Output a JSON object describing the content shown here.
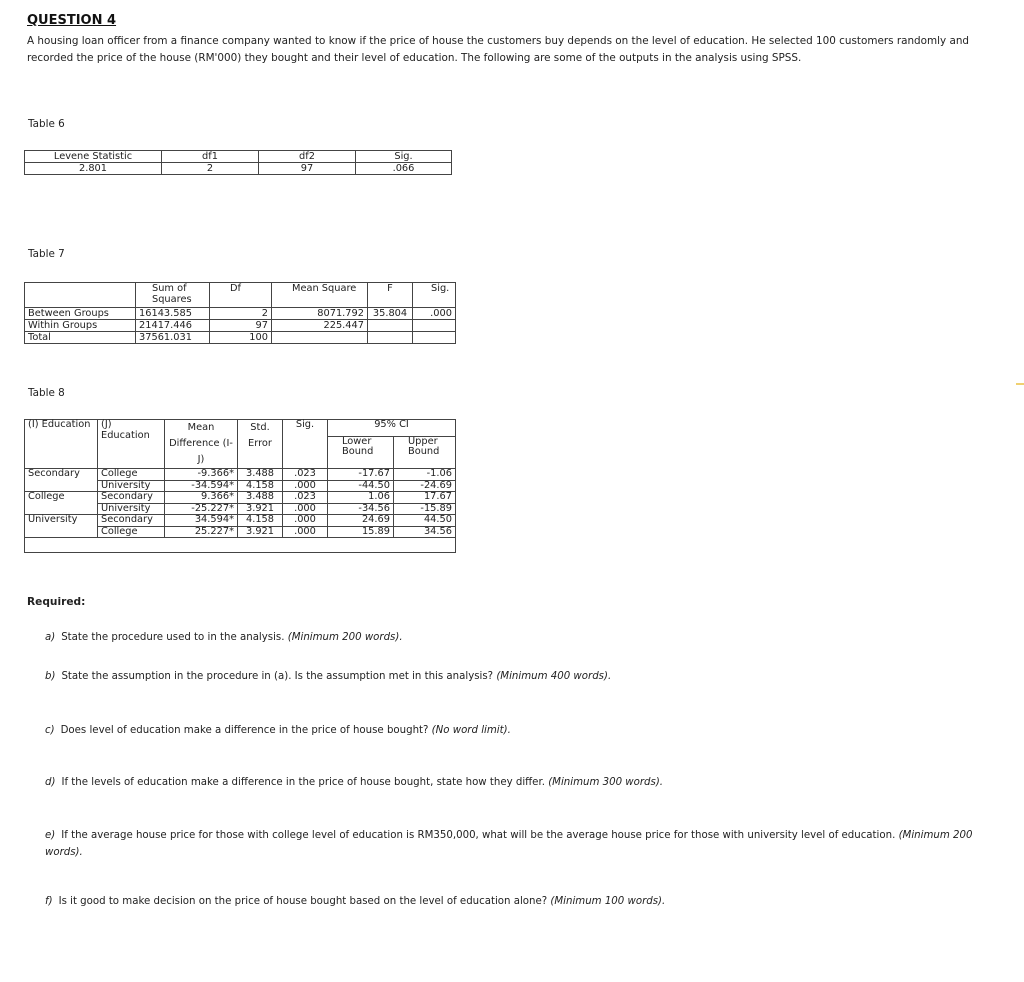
{
  "question": {
    "title": "QUESTION 4",
    "intro": "A housing loan officer from a finance company wanted to know if the price of house the customers buy depends on the level of education. He selected 100 customers randomly and recorded the price of the house (RM'000) they bought and their level of education. The following are some of the outputs in the analysis using SPSS."
  },
  "table6": {
    "label": "Table 6",
    "headers": [
      "Levene Statistic",
      "df1",
      "df2",
      "Sig."
    ],
    "row": [
      "2.801",
      "2",
      "97",
      ".066"
    ]
  },
  "table7": {
    "label": "Table 7",
    "headers": [
      "",
      "Sum of Squares",
      "Df",
      "Mean Square",
      "F",
      "Sig."
    ],
    "rows": [
      [
        "Between Groups",
        "16143.585",
        "2",
        "8071.792",
        "35.804",
        ".000"
      ],
      [
        "Within Groups",
        "21417.446",
        "97",
        "225.447",
        "",
        ""
      ],
      [
        "Total",
        "37561.031",
        "100",
        "",
        "",
        ""
      ]
    ]
  },
  "table8": {
    "label": "Table 8",
    "headers": {
      "i": "(I) Education",
      "j": "(J) Education",
      "mean_diff": "Mean Difference (I-J)",
      "std_error": "Std. Error",
      "sig": "Sig.",
      "ci": "95% CI",
      "lower": "Lower Bound",
      "upper": "Upper Bound"
    },
    "rows": [
      {
        "i": "Secondary",
        "j": "College",
        "md": "-9.366*",
        "se": "3.488",
        "sig": ".023",
        "lo": "-17.67",
        "hi": "-1.06"
      },
      {
        "i": "",
        "j": "University",
        "md": "-34.594*",
        "se": "4.158",
        "sig": ".000",
        "lo": "-44.50",
        "hi": "-24.69"
      },
      {
        "i": "College",
        "j": "Secondary",
        "md": "9.366*",
        "se": "3.488",
        "sig": ".023",
        "lo": "1.06",
        "hi": "17.67"
      },
      {
        "i": "",
        "j": "University",
        "md": "-25.227*",
        "se": "3.921",
        "sig": ".000",
        "lo": "-34.56",
        "hi": "-15.89"
      },
      {
        "i": "University",
        "j": "Secondary",
        "md": "34.594*",
        "se": "4.158",
        "sig": ".000",
        "lo": "24.69",
        "hi": "44.50"
      },
      {
        "i": "",
        "j": "College",
        "md": "25.227*",
        "se": "3.921",
        "sig": ".000",
        "lo": "15.89",
        "hi": "34.56"
      }
    ]
  },
  "required": {
    "label": "Required:",
    "items": [
      {
        "letter": "a)",
        "text": "State the procedure used to in the analysis.",
        "note": "(Minimum 200 words)."
      },
      {
        "letter": "b)",
        "text": "State the assumption in the procedure in (a). Is the assumption met in this analysis?",
        "note": "(Minimum 400 words)."
      },
      {
        "letter": "c)",
        "text": "Does level of education make a difference in the price of house bought?",
        "note": "(No word limit)."
      },
      {
        "letter": "d)",
        "text": "If the levels of education make a difference in the price of house bought, state how they differ.",
        "note": "(Minimum 300 words)."
      },
      {
        "letter": "e)",
        "text": "If the average house price for those with college level of education is RM350,000, what will be the average house price for those with university level of education.",
        "note": "(Minimum 200 words)."
      },
      {
        "letter": "f)",
        "text": "Is it good to make decision on the price of house bought based on the level of education alone?",
        "note": "(Minimum 100 words)."
      }
    ]
  }
}
